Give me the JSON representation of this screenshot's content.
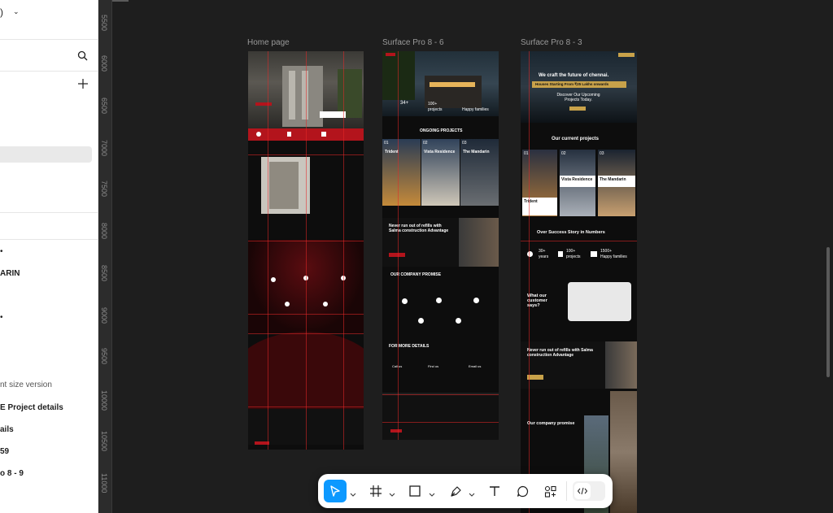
{
  "left_panel": {
    "items": [
      {
        "label": "ARIN"
      },
      {
        "label": "nt size version"
      },
      {
        "label": "E Project details"
      },
      {
        "label": "ails"
      },
      {
        "label": "59"
      },
      {
        "label": "o 8 - 9"
      }
    ]
  },
  "ruler": {
    "ticks": [
      "5500",
      "6000",
      "6500",
      "7000",
      "7500",
      "8000",
      "8500",
      "9000",
      "9500",
      "10000",
      "10500",
      "11000"
    ]
  },
  "frames": [
    {
      "label": "Home page"
    },
    {
      "label": "Surface Pro 8 - 6"
    },
    {
      "label": "Surface Pro 8 - 3"
    }
  ],
  "frame2": {
    "stats": [
      "34+",
      "100+",
      "projects",
      "Happy families"
    ],
    "ongoing_title": "ONGOING PROJECTS",
    "projects": [
      {
        "num": "01",
        "name": "Trident"
      },
      {
        "num": "02",
        "name": "Vista Residence"
      },
      {
        "num": "03",
        "name": "The Mandarin"
      }
    ],
    "refill": "Never run out of refills with Salma construction Advantage",
    "promise": "OUR COMPANY PROMISE",
    "more": "FOR MORE DETAILS",
    "contacts": [
      "Call us",
      "Find us",
      "Email us"
    ]
  },
  "frame3": {
    "hero_title": "We craft the future of chennai.",
    "hero_price": "Houses Starting From ₹25 Lakhs onwards",
    "hero_sub": "Discover Our Upcoming Projects Today.",
    "projects_title": "Our current projects",
    "projects": [
      {
        "num": "01",
        "name": "Trident"
      },
      {
        "num": "02",
        "name": "Vista Residence"
      },
      {
        "num": "03",
        "name": "The Mandarin"
      }
    ],
    "success_title": "Over Success Story in Numbers",
    "stats": [
      {
        "value": "30+",
        "label": "years"
      },
      {
        "value": "100+",
        "label": "projects"
      },
      {
        "value": "1500+",
        "label": "Happy families"
      }
    ],
    "testimonial_title": "What our customer says?",
    "refill": "Never run out of refills with Salma construction Advantage",
    "promise": "Our company promise"
  },
  "colors": {
    "accent": "#0d99ff",
    "brand_red": "#b3141c",
    "gold": "#c8a24a"
  },
  "toolbar": {
    "tools": [
      "move-icon",
      "frame-icon",
      "rectangle-icon",
      "pen-icon",
      "text-icon",
      "comment-icon",
      "components-icon",
      "dev-mode-icon"
    ]
  }
}
